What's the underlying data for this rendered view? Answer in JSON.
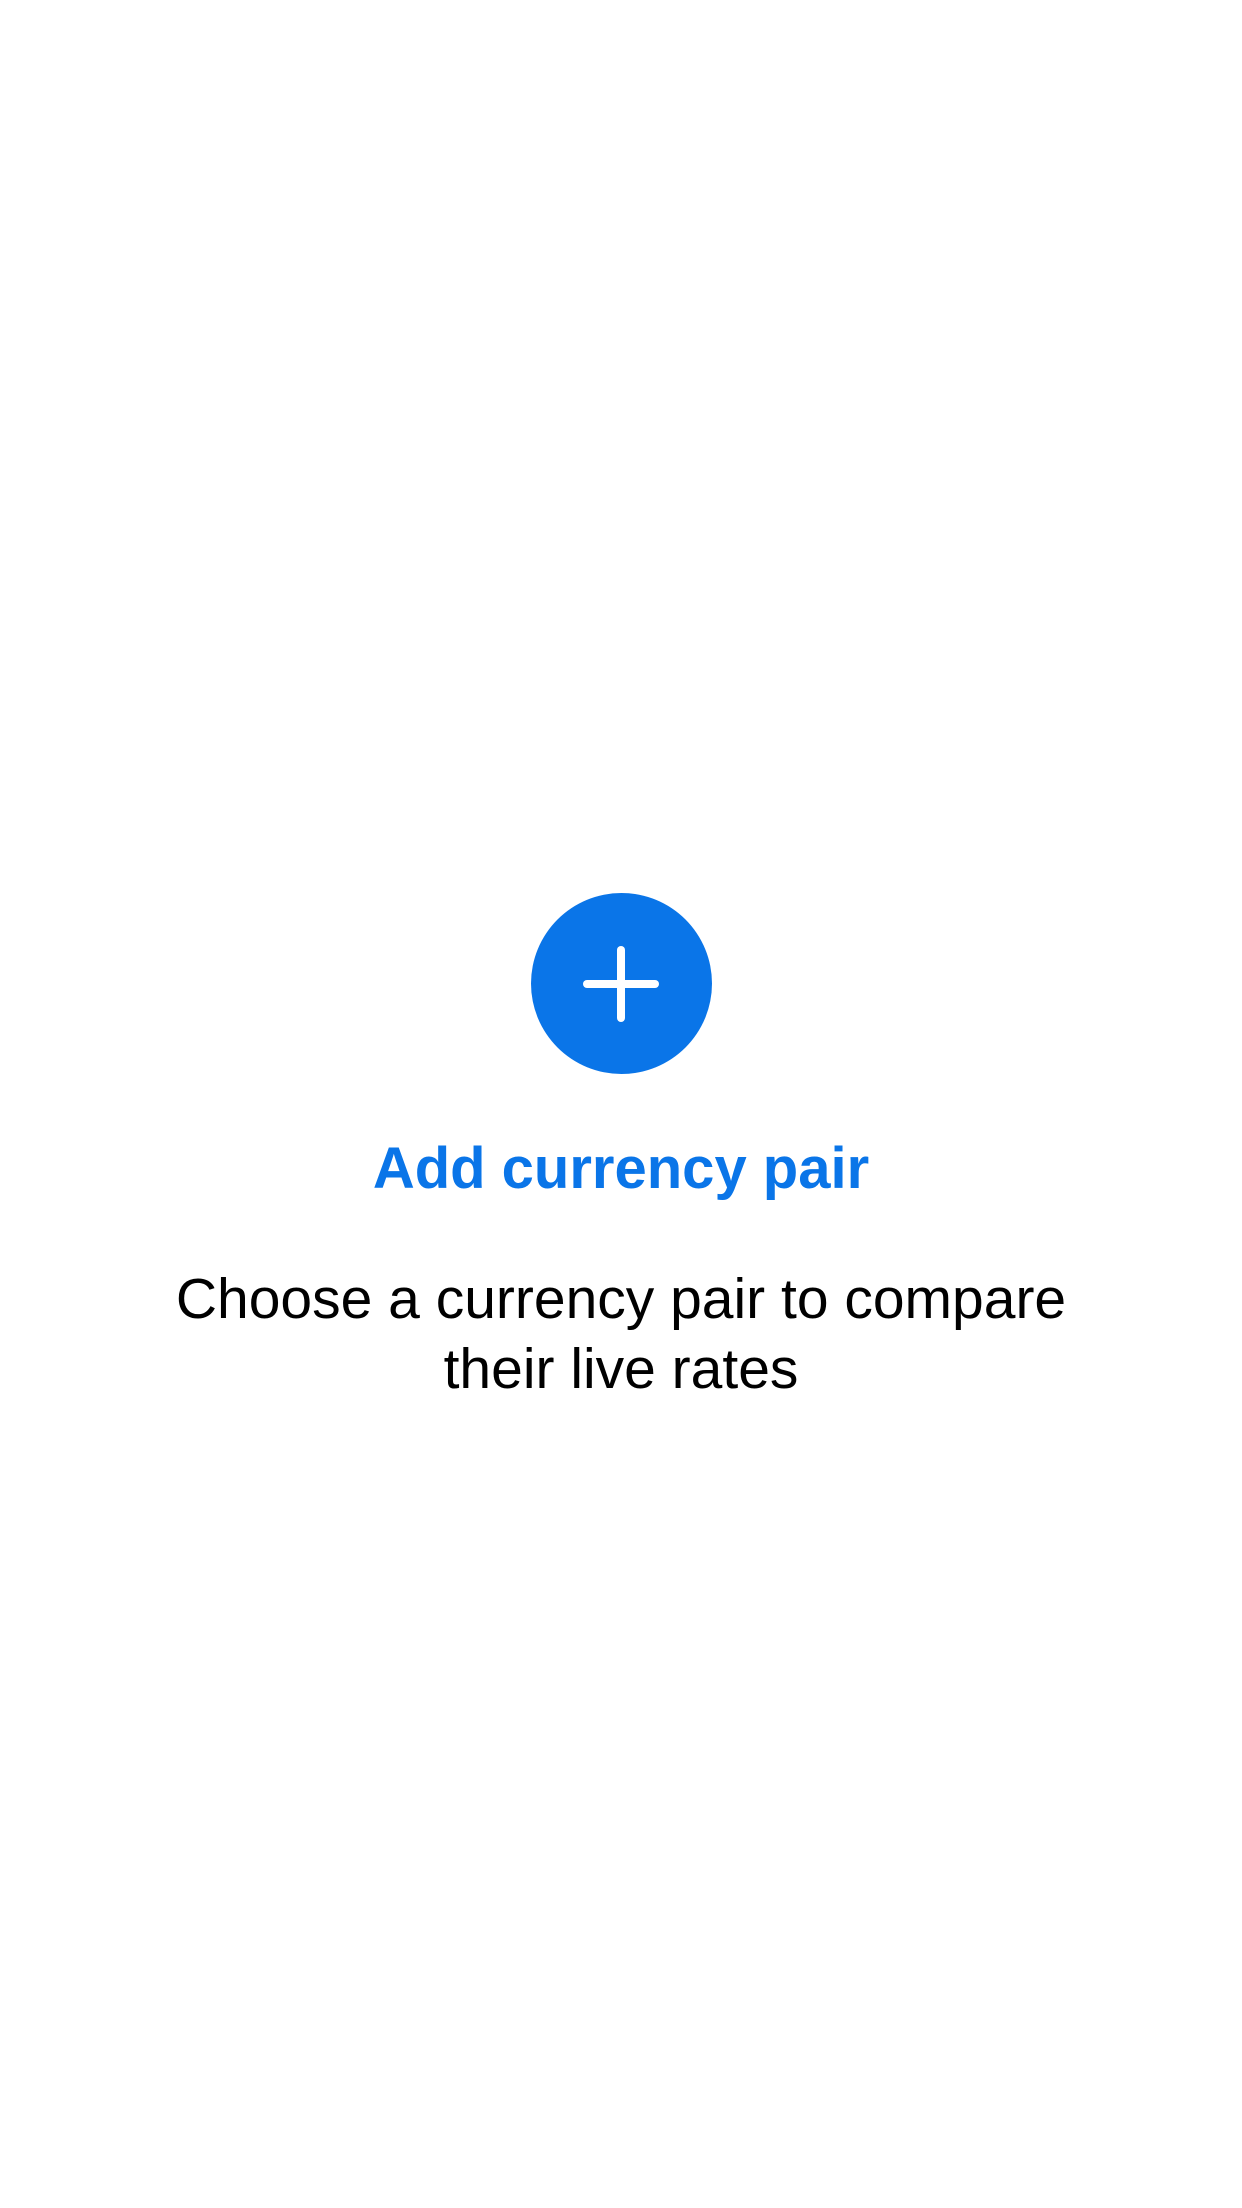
{
  "colors": {
    "accent": "#0A75E8",
    "background": "#FFFFFF",
    "text": "#000000"
  },
  "empty_state": {
    "icon": "plus-icon",
    "title": "Add currency pair",
    "description": "Choose a currency pair to compare their live rates"
  }
}
